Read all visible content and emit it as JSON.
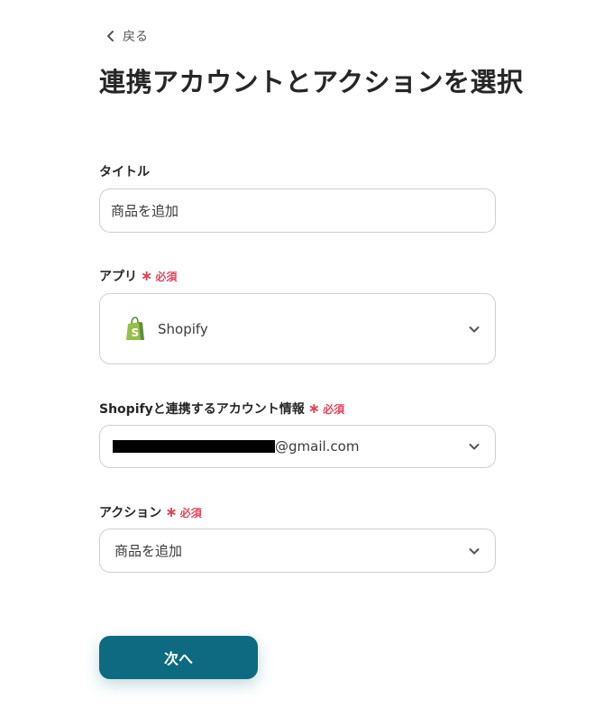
{
  "back": {
    "label": "戻る"
  },
  "page_title": "連携アカウントとアクションを選択",
  "required_label": "必須",
  "fields": {
    "title": {
      "label": "タイトル",
      "value": "商品を追加"
    },
    "app": {
      "label": "アプリ",
      "value": "Shopify",
      "icon": "shopify-bag-icon"
    },
    "account": {
      "label": "Shopifyと連携するアカウント情報",
      "value_suffix": "@gmail.com"
    },
    "action": {
      "label": "アクション",
      "value": "商品を追加"
    }
  },
  "next_button": {
    "label": "次へ"
  },
  "colors": {
    "accent": "#0d6a80",
    "required": "#e0455a",
    "shopify_green": "#95bf47"
  }
}
